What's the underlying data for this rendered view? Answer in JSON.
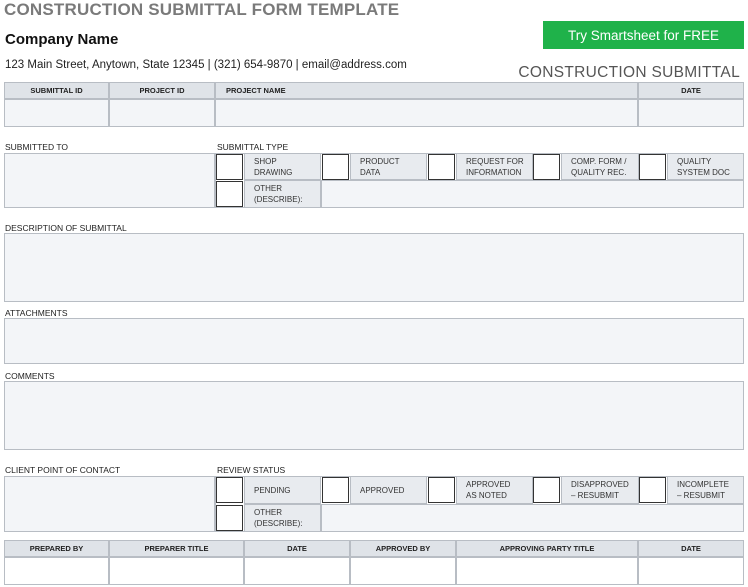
{
  "header": {
    "title": "CONSTRUCTION SUBMITTAL FORM TEMPLATE",
    "company_name": "Company Name",
    "address_line": "123 Main Street, Anytown, State 12345 | (321) 654-9870 | email@address.com",
    "subtitle": "CONSTRUCTION SUBMITTAL",
    "cta_label": "Try Smartsheet for FREE",
    "cta_color": "#1fb24a"
  },
  "top_table": {
    "headers": [
      "SUBMITTAL ID",
      "PROJECT ID",
      "PROJECT NAME",
      "DATE"
    ]
  },
  "sections": {
    "submitted_to": "SUBMITTED TO",
    "submittal_type": "SUBMITTAL TYPE",
    "description": "DESCRIPTION OF SUBMITTAL",
    "attachments": "ATTACHMENTS",
    "comments": "COMMENTS",
    "client_contact": "CLIENT POINT OF CONTACT",
    "review_status": "REVIEW STATUS"
  },
  "submittal_types": [
    {
      "line1": "SHOP",
      "line2": "DRAWING"
    },
    {
      "line1": "PRODUCT",
      "line2": "DATA"
    },
    {
      "line1": "REQUEST FOR",
      "line2": "INFORMATION"
    },
    {
      "line1": "COMP. FORM /",
      "line2": "QUALITY REC."
    },
    {
      "line1": "QUALITY",
      "line2": "SYSTEM DOC"
    }
  ],
  "submittal_other": {
    "line1": "OTHER",
    "line2": "(DESCRIBE):"
  },
  "review_statuses": [
    {
      "line1": "PENDING",
      "line2": ""
    },
    {
      "line1": "APPROVED",
      "line2": ""
    },
    {
      "line1": "APPROVED",
      "line2": "AS NOTED"
    },
    {
      "line1": "DISAPPROVED",
      "line2": "– RESUBMIT"
    },
    {
      "line1": "INCOMPLETE",
      "line2": "– RESUBMIT"
    }
  ],
  "review_other": {
    "line1": "OTHER",
    "line2": "(DESCRIBE):"
  },
  "bottom_table": {
    "headers": [
      "PREPARED BY",
      "PREPARER TITLE",
      "DATE",
      "APPROVED BY",
      "APPROVING PARTY TITLE",
      "DATE"
    ]
  }
}
